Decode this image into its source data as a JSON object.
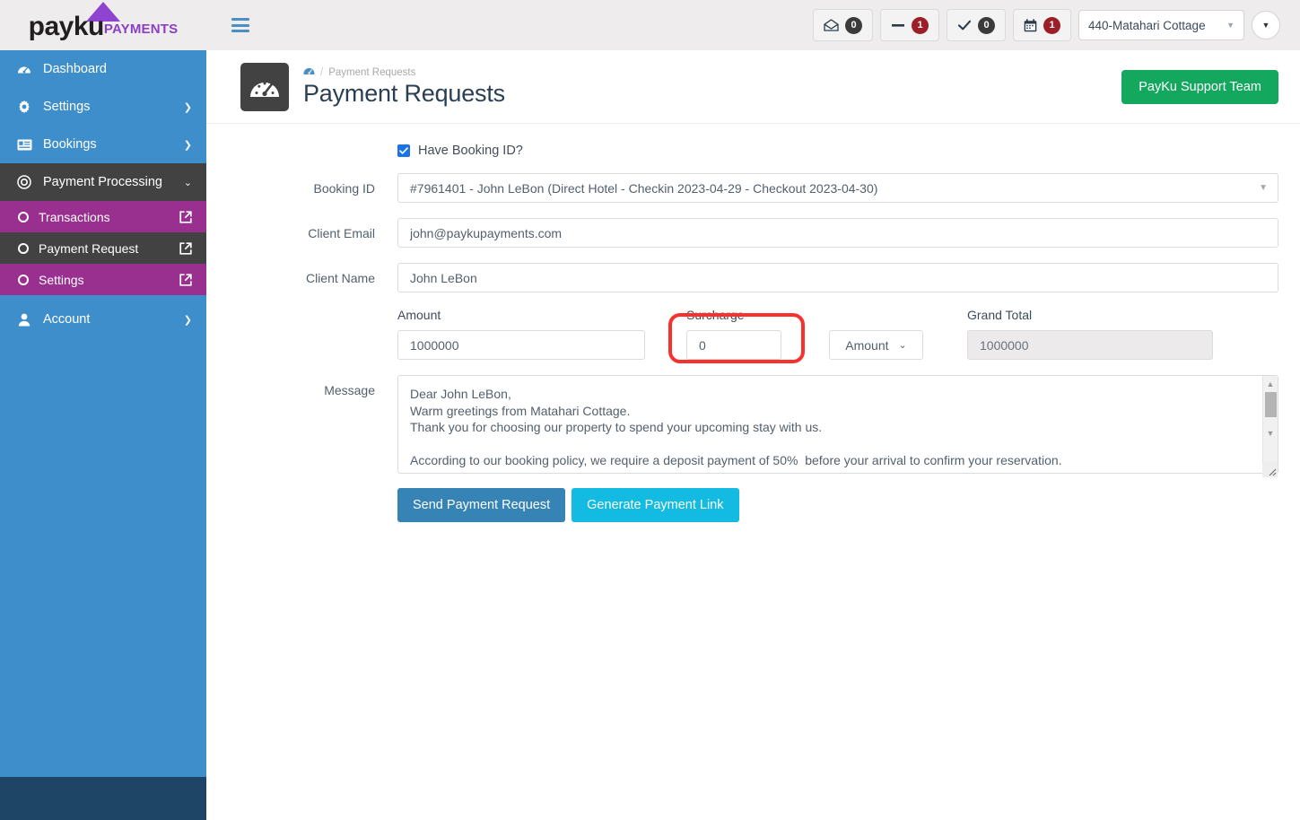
{
  "brand": {
    "name": "payku",
    "suffix": "PAYMENTS"
  },
  "topbar": {
    "menu_toggle": "hamburger-menu",
    "stats": [
      {
        "icon": "envelope-open-icon",
        "value": "0",
        "badge_style": "dark"
      },
      {
        "icon": "minus-icon",
        "value": "1",
        "badge_style": "red"
      },
      {
        "icon": "check-icon",
        "value": "0",
        "badge_style": "dark"
      },
      {
        "icon": "calendar-icon",
        "value": "1",
        "badge_style": "red"
      }
    ],
    "property_selected": "440-Matahari Cottage",
    "user_menu": "caret-down-icon"
  },
  "sidebar": {
    "items": [
      {
        "label": "Dashboard",
        "icon": "speedometer-icon",
        "has_chevron": false,
        "state": "normal"
      },
      {
        "label": "Settings",
        "icon": "gear-icon",
        "has_chevron": true,
        "state": "normal"
      },
      {
        "label": "Bookings",
        "icon": "id-card-icon",
        "has_chevron": true,
        "state": "normal"
      },
      {
        "label": "Payment Processing",
        "icon": "target-icon",
        "has_chevron": true,
        "state": "expanded"
      }
    ],
    "subitems": [
      {
        "label": "Transactions",
        "icon": "circle-icon",
        "external": "external-link-icon",
        "selected": false
      },
      {
        "label": "Payment Request",
        "icon": "circle-icon",
        "external": "external-link-icon",
        "selected": true
      },
      {
        "label": "Settings",
        "icon": "circle-icon",
        "external": "external-link-icon",
        "selected": false
      }
    ],
    "account": {
      "label": "Account",
      "icon": "user-icon",
      "has_chevron": true
    }
  },
  "header": {
    "breadcrumb_home": "dashboard-icon",
    "breadcrumb_sep": "/",
    "breadcrumb_current": "Payment Requests",
    "title": "Payment Requests",
    "support_button": "PayKu Support Team"
  },
  "form": {
    "have_booking_id": {
      "label": "Have Booking ID?",
      "checked": true
    },
    "booking_id": {
      "label": "Booking ID",
      "value": "#7961401 - John LeBon (Direct Hotel - Checkin 2023-04-29 - Checkout 2023-04-30)"
    },
    "client_email": {
      "label": "Client Email",
      "value": "john@paykupayments.com"
    },
    "client_name": {
      "label": "Client Name",
      "value": "John LeBon"
    },
    "amount": {
      "label": "Amount",
      "value": "1000000"
    },
    "surcharge": {
      "label": "Surcharge",
      "value": "0",
      "highlighted": true
    },
    "surcharge_type": {
      "value": "Amount"
    },
    "grand_total": {
      "label": "Grand Total",
      "value": "1000000",
      "disabled": true
    },
    "message": {
      "label": "Message",
      "value": "Dear John LeBon,\nWarm greetings from Matahari Cottage.\nThank you for choosing our property to spend your upcoming stay with us.\n\nAccording to our booking policy, we require a deposit payment of 50%  before your arrival to confirm your reservation."
    },
    "buttons": {
      "send": "Send Payment Request",
      "generate": "Generate Payment Link"
    }
  },
  "colors": {
    "sidebar_blue": "#3e8ecc",
    "sidebar_footer": "#1f4566",
    "submenu_magenta": "#99308f",
    "active_dark": "#434243",
    "support_green": "#14a85f",
    "send_blue": "#3683b5",
    "generate_cyan": "#13bbe3",
    "annotation_red": "#f8312f",
    "brand_purple": "#8e44d0"
  }
}
